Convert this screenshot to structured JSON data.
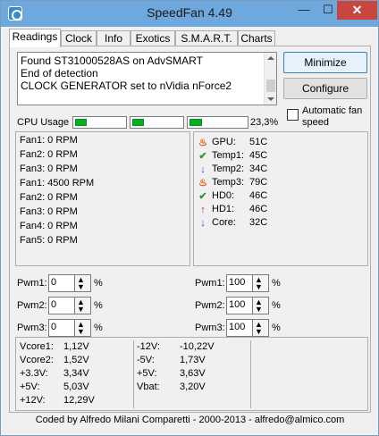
{
  "window": {
    "title": "SpeedFan 4.49",
    "minimize_glyph": "—",
    "maximize_glyph": "☐",
    "close_glyph": "✕"
  },
  "tabs": [
    {
      "label": "Readings",
      "active": true
    },
    {
      "label": "Clock"
    },
    {
      "label": "Info"
    },
    {
      "label": "Exotics"
    },
    {
      "label": "S.M.A.R.T."
    },
    {
      "label": "Charts"
    }
  ],
  "log": {
    "lines": [
      "Found ST31000528AS on AdvSMART",
      "End of detection",
      "CLOCK GENERATOR set to nVidia nForce2"
    ]
  },
  "buttons": {
    "minimize": "Minimize",
    "configure": "Configure"
  },
  "auto_fan": {
    "label_line1": "Automatic fan",
    "label_line2": "speed",
    "checked": false
  },
  "cpu_usage": {
    "label": "CPU Usage",
    "value_text": "23,3%",
    "cores": [
      0.23,
      0.23,
      0.23
    ]
  },
  "fans": [
    "Fan1: 0 RPM",
    "Fan2: 0 RPM",
    "Fan3: 0 RPM",
    "Fan1: 4500 RPM",
    "Fan2: 0 RPM",
    "Fan3: 0 RPM",
    "Fan4: 0 RPM",
    "Fan5: 0 RPM"
  ],
  "temps": [
    {
      "label": "GPU:",
      "value": "51C",
      "icon": "flame-icon"
    },
    {
      "label": "Temp1:",
      "value": "45C",
      "icon": "check-icon"
    },
    {
      "label": "Temp2:",
      "value": "34C",
      "icon": "down-arrow-icon"
    },
    {
      "label": "Temp3:",
      "value": "79C",
      "icon": "flame-icon"
    },
    {
      "label": "HD0:",
      "value": "46C",
      "icon": "check-icon"
    },
    {
      "label": "HD1:",
      "value": "46C",
      "icon": "up-arrow-icon"
    },
    {
      "label": "Core:",
      "value": "32C",
      "icon": "down-arrow-icon"
    }
  ],
  "pwm_left": [
    {
      "label": "Pwm1:",
      "value": "0",
      "unit": "%"
    },
    {
      "label": "Pwm2:",
      "value": "0",
      "unit": "%"
    },
    {
      "label": "Pwm3:",
      "value": "0",
      "unit": "%"
    }
  ],
  "pwm_right": [
    {
      "label": "Pwm1:",
      "value": "100",
      "unit": "%"
    },
    {
      "label": "Pwm2:",
      "value": "100",
      "unit": "%"
    },
    {
      "label": "Pwm3:",
      "value": "100",
      "unit": "%"
    }
  ],
  "voltages_left": [
    {
      "label": "Vcore1:",
      "value": "1,12V"
    },
    {
      "label": "Vcore2:",
      "value": "1,52V"
    },
    {
      "label": "+3.3V:",
      "value": "3,34V"
    },
    {
      "label": "+5V:",
      "value": "5,03V"
    },
    {
      "label": "+12V:",
      "value": "12,29V"
    }
  ],
  "voltages_right": [
    {
      "label": "-12V:",
      "value": "-10,22V"
    },
    {
      "label": "-5V:",
      "value": "1,73V"
    },
    {
      "label": "+5V:",
      "value": "3,63V"
    },
    {
      "label": "Vbat:",
      "value": "3,20V"
    }
  ],
  "footer": "Coded by Alfredo Milani Comparetti - 2000-2013 - alfredo@almico.com"
}
